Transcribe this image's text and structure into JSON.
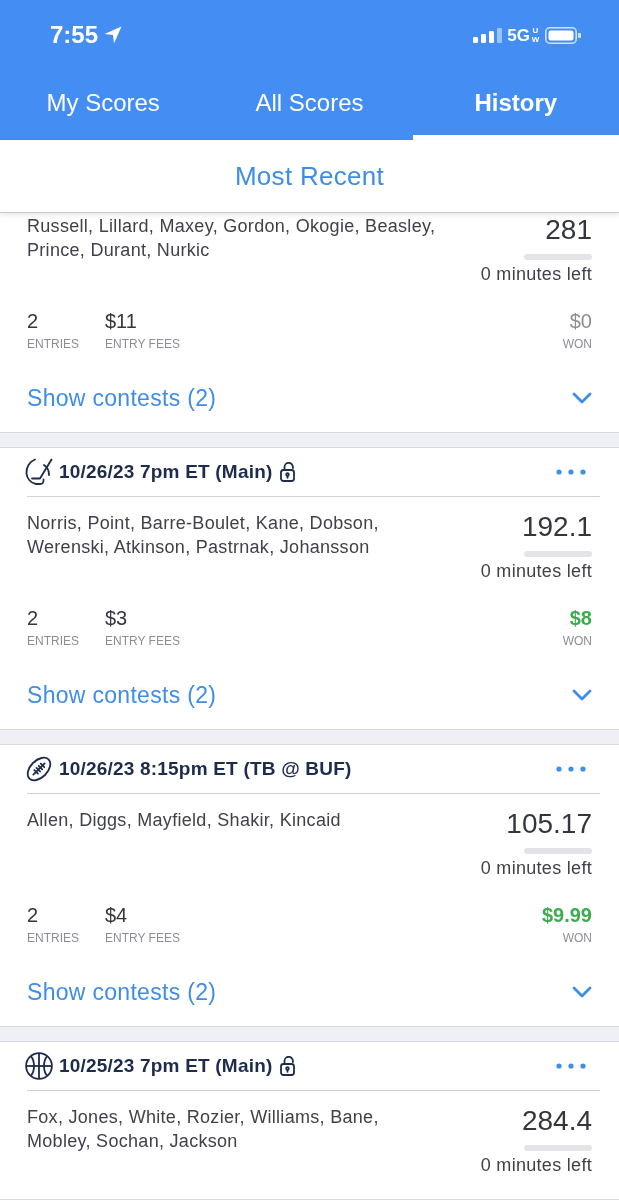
{
  "status_bar": {
    "time": "7:55",
    "network": "5G",
    "network_badge": "UW"
  },
  "tabs": [
    {
      "label": "My Scores",
      "selected": false
    },
    {
      "label": "All Scores",
      "selected": false
    },
    {
      "label": "History",
      "selected": true
    }
  ],
  "sort": {
    "label": "Most Recent"
  },
  "lineups": [
    {
      "players": "Russell, Lillard, Maxey, Gordon, Okogie, Beasley, Prince, Durant, Nurkic",
      "score": "281",
      "time_left": "0 minutes left",
      "entries": "2",
      "entries_label": "ENTRIES",
      "fees": "$11",
      "fees_label": "ENTRY FEES",
      "won": "$0",
      "won_label": "WON",
      "in_money": false,
      "show_contests": "Show contests (2)",
      "expanded": false
    },
    {
      "kind": "hockey",
      "title": "10/26/23 7pm ET (Main)",
      "unlocked": true,
      "players": "Norris, Point, Barre-Boulet, Kane, Dobson, Werenski, Atkinson, Pastrnak, Johansson",
      "score": "192.1",
      "time_left": "0 minutes left",
      "entries": "2",
      "entries_label": "ENTRIES",
      "fees": "$3",
      "fees_label": "ENTRY FEES",
      "won": "$8",
      "won_label": "WON",
      "in_money": true,
      "show_contests": "Show contests (2)",
      "expanded": false
    },
    {
      "kind": "football",
      "title": "10/26/23 8:15pm ET (TB @ BUF)",
      "unlocked": false,
      "players": "Allen, Diggs, Mayfield, Shakir, Kincaid",
      "score": "105.17",
      "time_left": "0 minutes left",
      "entries": "2",
      "entries_label": "ENTRIES",
      "fees": "$4",
      "fees_label": "ENTRY FEES",
      "won": "$9.99",
      "won_label": "WON",
      "in_money": true,
      "show_contests": "Show contests (2)",
      "expanded": false
    },
    {
      "kind": "basketball",
      "title": "10/25/23 7pm ET (Main)",
      "unlocked": true,
      "players": "Fox, Jones, White, Rozier, Williams, Bane, Mobley, Sochan, Jackson",
      "score": "284.4",
      "time_left": "0 minutes left"
    }
  ]
}
